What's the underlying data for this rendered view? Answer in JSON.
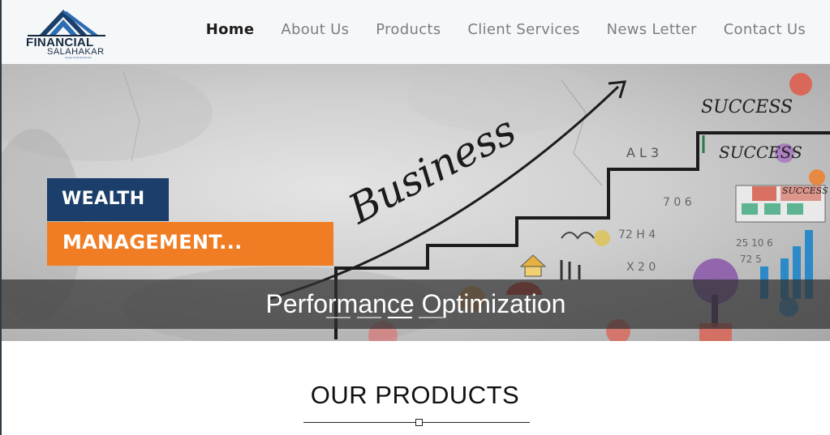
{
  "brand": {
    "name_line1": "FINANCIAL",
    "name_line2": "SALAHAKAR",
    "tagline": "Assets Financial Service",
    "icon": "roof-triangle-logo-icon",
    "colors": {
      "navy": "#1b3f6a",
      "blue": "#2b6cb3"
    }
  },
  "nav": {
    "items": [
      {
        "label": "Home",
        "active": true
      },
      {
        "label": "About Us"
      },
      {
        "label": "Products"
      },
      {
        "label": "Client Services"
      },
      {
        "label": "News Letter"
      },
      {
        "label": "Contact Us"
      }
    ]
  },
  "hero": {
    "badge_line1": "WEALTH",
    "badge_line2": "MANAGEMENT...",
    "sketch_word": "Business",
    "sketch_success_1": "SUCCESS",
    "sketch_success_2": "SUCCESS",
    "sketch_success_3": "SUCCESS",
    "caption": "Performance Optimization",
    "slides_total": 4,
    "active_slide": 3,
    "colors": {
      "badge_navy": "#1b3f6a",
      "badge_orange": "#f07d24"
    }
  },
  "products": {
    "heading": "OUR PRODUCTS"
  }
}
